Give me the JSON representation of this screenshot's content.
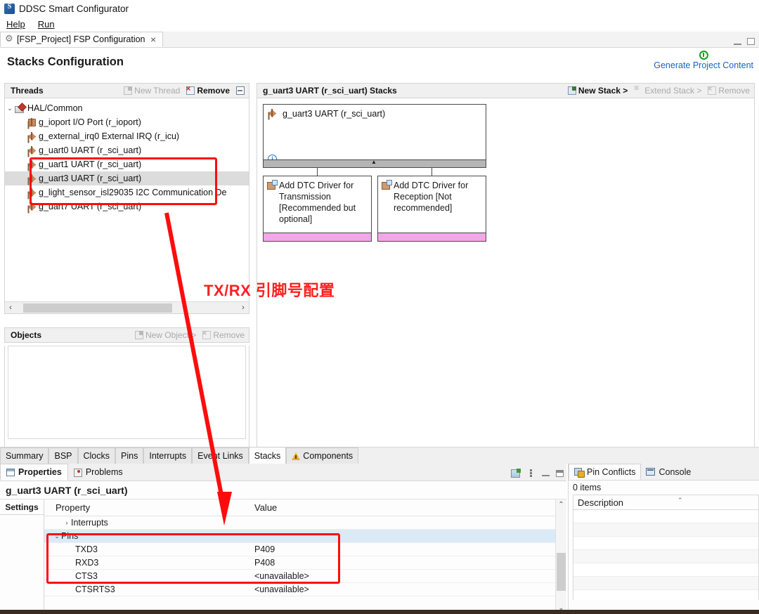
{
  "app": {
    "title": "DDSC Smart Configurator",
    "icon": "app-icon",
    "menu": [
      "Help",
      "Run"
    ]
  },
  "editor_tab": {
    "label": "[FSP_Project] FSP Configuration",
    "close": "⨯",
    "icon": "gear-icon"
  },
  "page": {
    "title": "Stacks Configuration",
    "generate_link": "Generate Project Content"
  },
  "threads": {
    "title": "Threads",
    "new_label": "New Thread",
    "remove_label": "Remove",
    "tree": [
      {
        "label": "HAL/Common",
        "level": 0,
        "icon": "hal-icon",
        "expanded": true,
        "selected": false
      },
      {
        "label": "g_ioport I/O Port (r_ioport)",
        "level": 1,
        "icon": "module-icon",
        "selected": false
      },
      {
        "label": "g_external_irq0 External IRQ (r_icu)",
        "level": 1,
        "icon": "module-icon",
        "selected": false
      },
      {
        "label": "g_uart0 UART (r_sci_uart)",
        "level": 1,
        "icon": "module-icon",
        "selected": false
      },
      {
        "label": "g_uart1 UART (r_sci_uart)",
        "level": 1,
        "icon": "module-icon",
        "selected": false
      },
      {
        "label": "g_uart3 UART (r_sci_uart)",
        "level": 1,
        "icon": "module-icon",
        "selected": true
      },
      {
        "label": "g_light_sensor_isl29035 I2C Communication De",
        "level": 1,
        "icon": "module-icon",
        "selected": false
      },
      {
        "label": "g_uart7 UART (r_sci_uart)",
        "level": 1,
        "icon": "module-icon",
        "selected": false
      }
    ]
  },
  "objects": {
    "title": "Objects",
    "new_label": "New Object >",
    "remove_label": "Remove"
  },
  "stacks": {
    "title": "g_uart3 UART (r_sci_uart) Stacks",
    "new_stack_label": "New Stack >",
    "extend_stack_label": "Extend Stack >",
    "remove_label": "Remove",
    "root_box": {
      "label": "g_uart3 UART (r_sci_uart)",
      "icon": "module-icon",
      "info_icon": "info-icon"
    },
    "children": [
      {
        "label": "Add DTC Driver for Transmission [Recommended but optional]",
        "icon": "dtc-driver-icon",
        "footer_color": "#f2a7e8"
      },
      {
        "label": "Add DTC Driver for Reception [Not recommended]",
        "icon": "dtc-driver-icon",
        "footer_color": "#f2a7e8"
      }
    ]
  },
  "view_tabs": [
    {
      "label": "Summary",
      "active": false
    },
    {
      "label": "BSP",
      "active": false
    },
    {
      "label": "Clocks",
      "active": false
    },
    {
      "label": "Pins",
      "active": false
    },
    {
      "label": "Interrupts",
      "active": false
    },
    {
      "label": "Event Links",
      "active": false
    },
    {
      "label": "Stacks",
      "active": true
    },
    {
      "label": "Components",
      "active": false,
      "icon": "warning-icon"
    }
  ],
  "properties": {
    "tabs": [
      {
        "label": "Properties",
        "icon": "properties-icon",
        "active": true
      },
      {
        "label": "Problems",
        "icon": "problems-icon",
        "active": false
      }
    ],
    "header": "g_uart3 UART (r_sci_uart)",
    "side_tab": "Settings",
    "columns": {
      "property": "Property",
      "value": "Value"
    },
    "rows": [
      {
        "property": "Interrupts",
        "value": "",
        "indent": 1,
        "expander": "›",
        "selected": false
      },
      {
        "property": "Pins",
        "value": "",
        "indent": 0,
        "expander": "⌄",
        "selected": true
      },
      {
        "property": "TXD3",
        "value": "P409",
        "indent": 2,
        "expander": "",
        "selected": false
      },
      {
        "property": "RXD3",
        "value": "P408",
        "indent": 2,
        "expander": "",
        "selected": false
      },
      {
        "property": "CTS3",
        "value": "<unavailable>",
        "indent": 2,
        "expander": "",
        "selected": false
      },
      {
        "property": "CTSRTS3",
        "value": "<unavailable>",
        "indent": 2,
        "expander": "",
        "selected": false
      }
    ]
  },
  "pin_conflicts": {
    "tabs": [
      {
        "label": "Pin Conflicts",
        "icon": "pin-conflicts-icon",
        "active": true
      },
      {
        "label": "Console",
        "icon": "console-icon",
        "active": false
      }
    ],
    "count_label": "0 items",
    "column": "Description"
  },
  "annotations": {
    "callout_text": "TX/RX 引脚号配置",
    "color": "#fc0d0d",
    "boxes": [
      "threads-uart-group",
      "pins-txd-rxd"
    ],
    "arrow": "threads-to-pins-arrow"
  }
}
